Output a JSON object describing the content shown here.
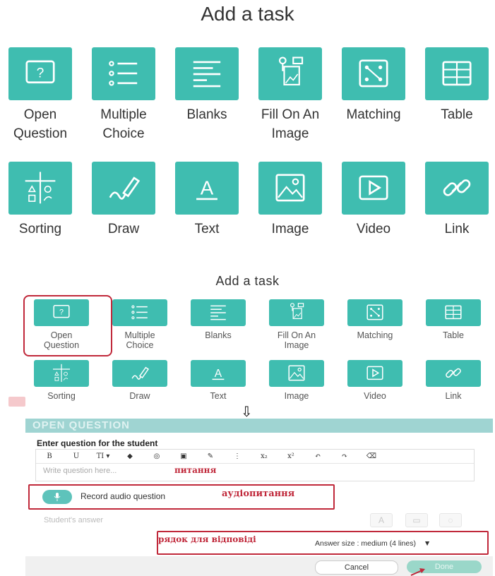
{
  "top": {
    "title": "Add a task",
    "row1": [
      {
        "icon": "question-mark-icon",
        "label": [
          "Open",
          "Question"
        ]
      },
      {
        "icon": "list-icon",
        "label": [
          "Multiple",
          "Choice"
        ]
      },
      {
        "icon": "lines-icon",
        "label": [
          "Blanks"
        ]
      },
      {
        "icon": "image-pin-icon",
        "label": [
          "Fill On An",
          "Image"
        ]
      },
      {
        "icon": "matching-icon",
        "label": [
          "Matching"
        ]
      },
      {
        "icon": "table-icon",
        "label": [
          "Table"
        ]
      }
    ],
    "row2": [
      {
        "icon": "sorting-icon",
        "label": [
          "Sorting"
        ]
      },
      {
        "icon": "pencil-icon",
        "label": [
          "Draw"
        ]
      },
      {
        "icon": "text-a-icon",
        "label": [
          "Text"
        ]
      },
      {
        "icon": "image-icon",
        "label": [
          "Image"
        ]
      },
      {
        "icon": "video-play-icon",
        "label": [
          "Video"
        ]
      },
      {
        "icon": "link-icon",
        "label": [
          "Link"
        ]
      }
    ]
  },
  "bottom": {
    "title": "Add a task",
    "row1": [
      {
        "label": [
          "Open",
          "Question"
        ]
      },
      {
        "label": [
          "Multiple",
          "Choice"
        ]
      },
      {
        "label": [
          "Blanks"
        ]
      },
      {
        "label": [
          "Fill On An",
          "Image"
        ]
      },
      {
        "label": [
          "Matching"
        ]
      },
      {
        "label": [
          "Table"
        ]
      }
    ],
    "row2": [
      {
        "label": [
          "Sorting"
        ]
      },
      {
        "label": [
          "Draw"
        ]
      },
      {
        "label": [
          "Text"
        ]
      },
      {
        "label": [
          "Image"
        ]
      },
      {
        "label": [
          "Video"
        ]
      },
      {
        "label": [
          "Link"
        ]
      }
    ],
    "arrow": "⇩"
  },
  "dialog": {
    "header": "OPEN QUESTION",
    "enter_label": "Enter question for the student",
    "toolbar": [
      "B",
      "U",
      "TI ▾",
      "◆",
      "◎",
      "▣",
      "✎",
      "⋮",
      "x₂",
      "x²",
      "↶",
      "↷",
      "⌫"
    ],
    "placeholder": "Write question here...",
    "annotation_question": "питання",
    "record_label": "Record audio question",
    "annotation_audio": "аудіопитання",
    "students_answer": "Student's answer",
    "answer_buttons": [
      "A",
      "▭",
      "◌"
    ],
    "annotation_answer": "рядок для відповіді",
    "answer_size": "Answer size : medium (4 lines)",
    "cancel": "Cancel",
    "done": "Done"
  },
  "colors": {
    "teal": "#3fbdb0",
    "annotation": "#c0283a"
  }
}
